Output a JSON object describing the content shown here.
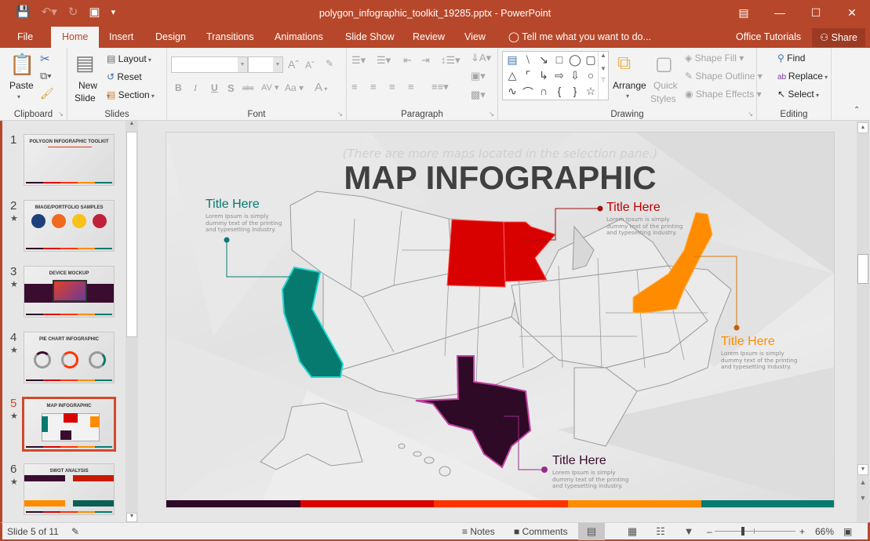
{
  "window": {
    "title": "polygon_infographic_toolkit_19285.pptx - PowerPoint",
    "qat": [
      "save-icon",
      "undo-icon",
      "redo-icon",
      "present-icon",
      "customize-icon"
    ],
    "controls": [
      "ribbon-display-icon",
      "minimize-icon",
      "maximize-icon",
      "close-icon"
    ]
  },
  "tabs": [
    "File",
    "Home",
    "Insert",
    "Design",
    "Transitions",
    "Animations",
    "Slide Show",
    "Review",
    "View"
  ],
  "active_tab": "Home",
  "tell_me": "Tell me what you want to do...",
  "office_tutorials": "Office Tutorials",
  "share": "Share",
  "ribbon": {
    "clipboard": {
      "label": "Clipboard",
      "paste": "Paste"
    },
    "slides": {
      "label": "Slides",
      "new_slide_1": "New",
      "new_slide_2": "Slide",
      "layout": "Layout",
      "reset": "Reset",
      "section": "Section"
    },
    "font": {
      "label": "Font",
      "font_name": "",
      "font_size": "",
      "bold": "B",
      "italic": "I",
      "underline": "U",
      "shadow": "S",
      "strike": "abc",
      "spacing": "AV",
      "case": "Aa",
      "color": "A",
      "grow": "Aˆ",
      "shrink": "Aˇ"
    },
    "paragraph": {
      "label": "Paragraph"
    },
    "drawing": {
      "label": "Drawing",
      "arrange": "Arrange",
      "quick_1": "Quick",
      "quick_2": "Styles",
      "shape_fill": "Shape Fill",
      "shape_outline": "Shape Outline",
      "shape_effects": "Shape Effects"
    },
    "editing": {
      "label": "Editing",
      "find": "Find",
      "replace": "Replace",
      "select": "Select"
    }
  },
  "thumbnails": [
    {
      "num": "1",
      "title": "POLYGON INFOGRAPHIC TOOLKIT",
      "star": false
    },
    {
      "num": "2",
      "title": "IMAGE/PORTFOLIO SAMPLES",
      "star": true
    },
    {
      "num": "3",
      "title": "DEVICE MOCKUP",
      "star": true
    },
    {
      "num": "4",
      "title": "PIE CHART INFOGRAPHIC",
      "star": true
    },
    {
      "num": "5",
      "title": "MAP INFOGRAPHIC",
      "star": true,
      "selected": true
    },
    {
      "num": "6",
      "title": "SWOT ANALYSIS",
      "star": true
    }
  ],
  "slide": {
    "hint": "(There are more maps located in the selection pane.)",
    "title": "MAP INFOGRAPHIC",
    "callouts": [
      {
        "title": "Title Here",
        "text": "Lorem Ipsum is simply dummy text of the printing and typesetting industry.",
        "color": "#067a6f",
        "region": "California"
      },
      {
        "title": "Title Here",
        "text": "Lorem Ipsum is simply dummy text of the printing and typesetting industry.",
        "color": "#c00000",
        "region": "North Dakota, South Dakota, Minnesota"
      },
      {
        "title": "Title Here",
        "text": "Lorem Ipsum is simply dummy text of the printing and typesetting industry.",
        "color": "#ff8c00",
        "region": "Northeast"
      },
      {
        "title": "Title Here",
        "text": "Lorem Ipsum is simply dummy text of the printing and typesetting industry.",
        "color": "#3a0c30",
        "region": "Texas"
      }
    ],
    "colorbar": [
      "#2e0a26",
      "#d90000",
      "#ff3300",
      "#ff8c00",
      "#067a6f"
    ]
  },
  "status": {
    "slide_info": "Slide 5 of 11",
    "notes": "Notes",
    "comments": "Comments",
    "zoom": "66%",
    "zoom_fraction": 0.35
  }
}
